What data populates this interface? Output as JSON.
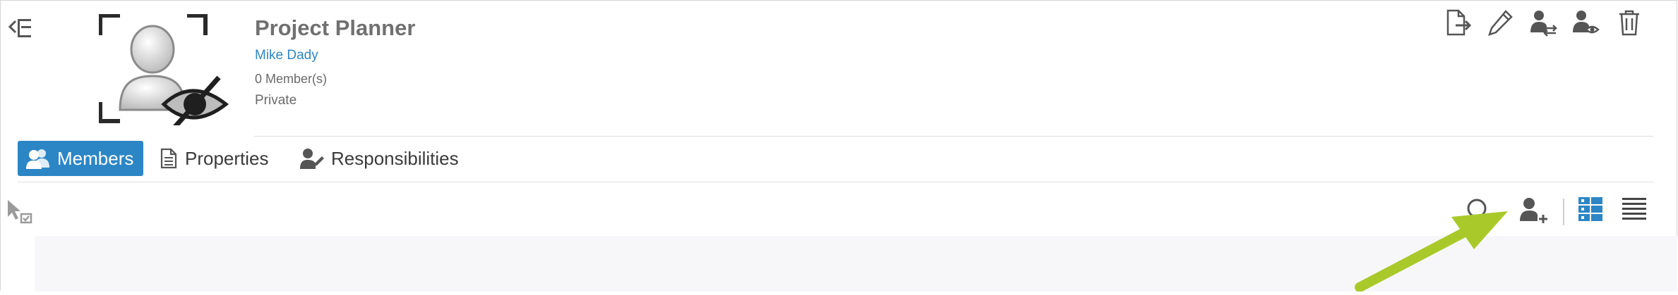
{
  "header": {
    "title": "Project Planner",
    "owner": "Mike Dady",
    "member_count": "0 Member(s)",
    "privacy": "Private",
    "actions": [
      "leave-icon",
      "edit-icon",
      "transfer-user-icon",
      "user-visibility-icon",
      "trash-icon"
    ]
  },
  "tabs": [
    {
      "label": "Members",
      "icon": "members-icon",
      "active": true
    },
    {
      "label": "Properties",
      "icon": "document-icon",
      "active": false
    },
    {
      "label": "Responsibilities",
      "icon": "responsibilities-icon",
      "active": false
    }
  ],
  "toolbar": {
    "icons": [
      "search-icon",
      "add-member-icon",
      "card-view-icon",
      "list-view-icon"
    ],
    "active_view": "card-view"
  },
  "colors": {
    "accent": "#2c86c5",
    "link": "#2f86c4",
    "annotation_arrow": "#a9c92a"
  }
}
